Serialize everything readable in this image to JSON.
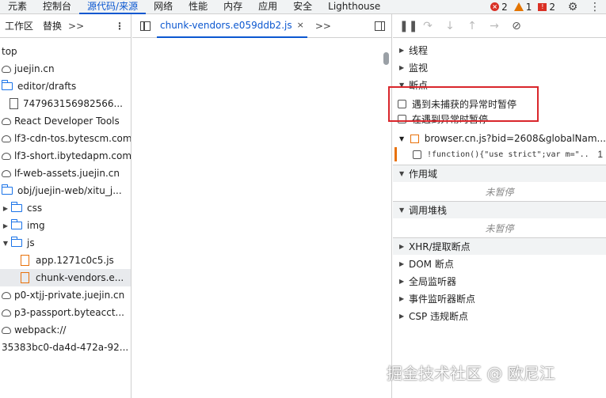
{
  "topbar": {
    "tabs": [
      "元素",
      "控制台",
      "源代码/来源",
      "网络",
      "性能",
      "内存",
      "应用",
      "安全",
      "Lighthouse"
    ],
    "active_index": 2,
    "errors": "2",
    "warnings": "1",
    "issues": "2"
  },
  "navigator": {
    "tabs": [
      "工作区",
      "替换"
    ],
    "more": ">>",
    "kebab": "⋮",
    "nodes": [
      {
        "label": "top",
        "icon": "none",
        "indent": 0
      },
      {
        "label": "juejin.cn",
        "icon": "cloud",
        "indent": 0
      },
      {
        "label": "editor/drafts",
        "icon": "folder",
        "indent": 0
      },
      {
        "label": "747963156982566...",
        "icon": "file",
        "indent": 1
      },
      {
        "label": "React Developer Tools",
        "icon": "cloud",
        "indent": 0
      },
      {
        "label": "lf3-cdn-tos.bytescm.com",
        "icon": "cloud",
        "indent": 0
      },
      {
        "label": "lf3-short.ibytedapm.com",
        "icon": "cloud",
        "indent": 0
      },
      {
        "label": "lf-web-assets.juejin.cn",
        "icon": "cloud",
        "indent": 0
      },
      {
        "label": "obj/juejin-web/xitu_j...",
        "icon": "folder",
        "indent": 0
      },
      {
        "label": "css",
        "icon": "folder-collapsed",
        "indent": 0
      },
      {
        "label": "img",
        "icon": "folder-collapsed",
        "indent": 0
      },
      {
        "label": "js",
        "icon": "folder-expanded",
        "indent": 0
      },
      {
        "label": "app.1271c0c5.js",
        "icon": "js",
        "indent": 2
      },
      {
        "label": "chunk-vendors.e...",
        "icon": "js",
        "indent": 2,
        "selected": true
      },
      {
        "label": "p0-xtjj-private.juejin.cn",
        "icon": "cloud",
        "indent": 0
      },
      {
        "label": "p3-passport.byteacct...",
        "icon": "cloud",
        "indent": 0
      },
      {
        "label": "webpack://",
        "icon": "cloud",
        "indent": 0
      },
      {
        "label": "35383bc0-da4d-472a-92...",
        "icon": "none",
        "indent": 0
      }
    ]
  },
  "editor": {
    "file_tab": "chunk-vendors.e059ddb2.js",
    "close": "×",
    "more": ">>"
  },
  "debugger": {
    "sections_top": [
      "线程",
      "监视"
    ],
    "breakpoints_label": "断点",
    "exception_options": [
      "遇到未捕获的异常时暂停",
      "在遇到异常时暂停"
    ],
    "bp_file": "browser.cn.js?bid=2608&globalNam...",
    "bp_code": "!function(){\"use strict\";var m=\"..",
    "bp_line": "1",
    "scope_label": "作用域",
    "not_paused": "未暂停",
    "callstack_label": "调用堆栈",
    "sections_bottom": [
      "XHR/提取断点",
      "DOM 断点",
      "全局监听器",
      "事件监听器断点",
      "CSP 违规断点"
    ]
  },
  "watermark": "掘金技术社区 @ 欧尼江"
}
